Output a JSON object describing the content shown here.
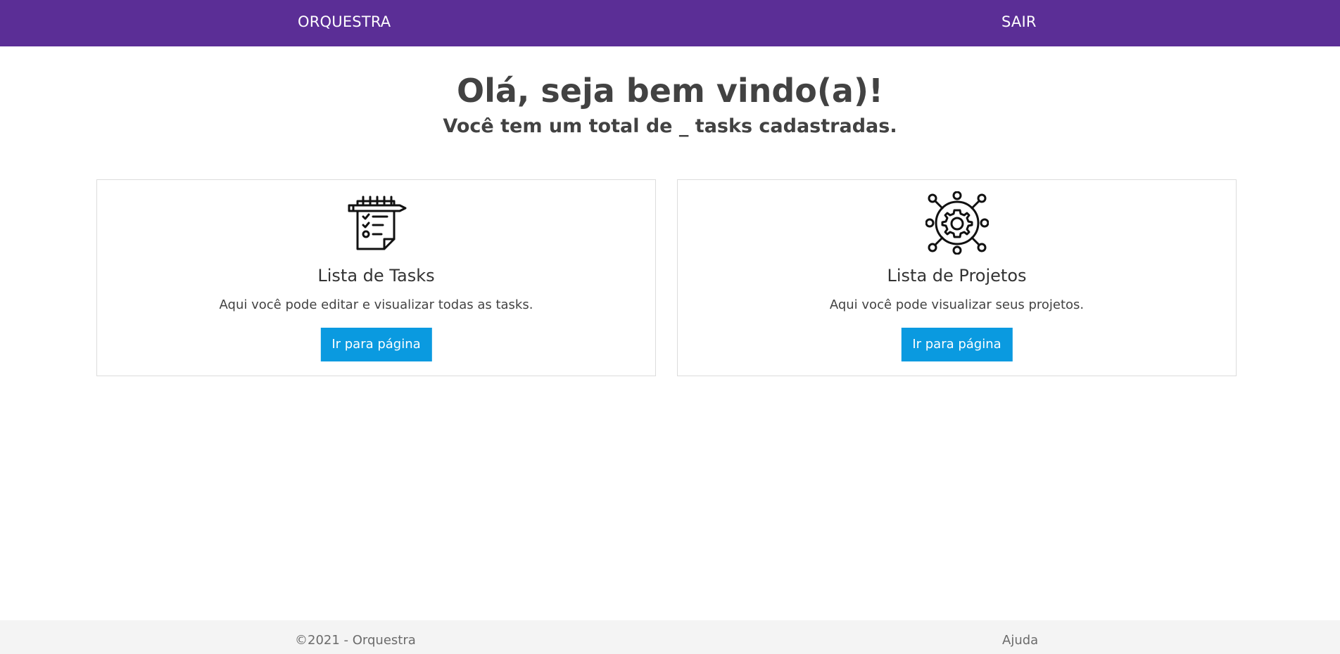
{
  "navbar": {
    "brand": "ORQUESTRA",
    "logout": "SAIR",
    "background_color": "#5b2e96"
  },
  "hero": {
    "title": "Olá, seja bem vindo(a)!",
    "subtitle": "Você tem um total de _ tasks cadastradas."
  },
  "cards": [
    {
      "icon": "task-checklist-icon",
      "title": "Lista de Tasks",
      "description": "Aqui você pode editar e visualizar todas as tasks.",
      "button_label": "Ir para página"
    },
    {
      "icon": "gear-network-icon",
      "title": "Lista de Projetos",
      "description": "Aqui você pode visualizar seus projetos.",
      "button_label": "Ir para página"
    }
  ],
  "footer": {
    "copyright": "©2021 - Orquestra",
    "help": "Ajuda"
  },
  "colors": {
    "accent_button": "#0a9ae0",
    "text": "#424242",
    "footer_bg": "#f4f4f4"
  }
}
